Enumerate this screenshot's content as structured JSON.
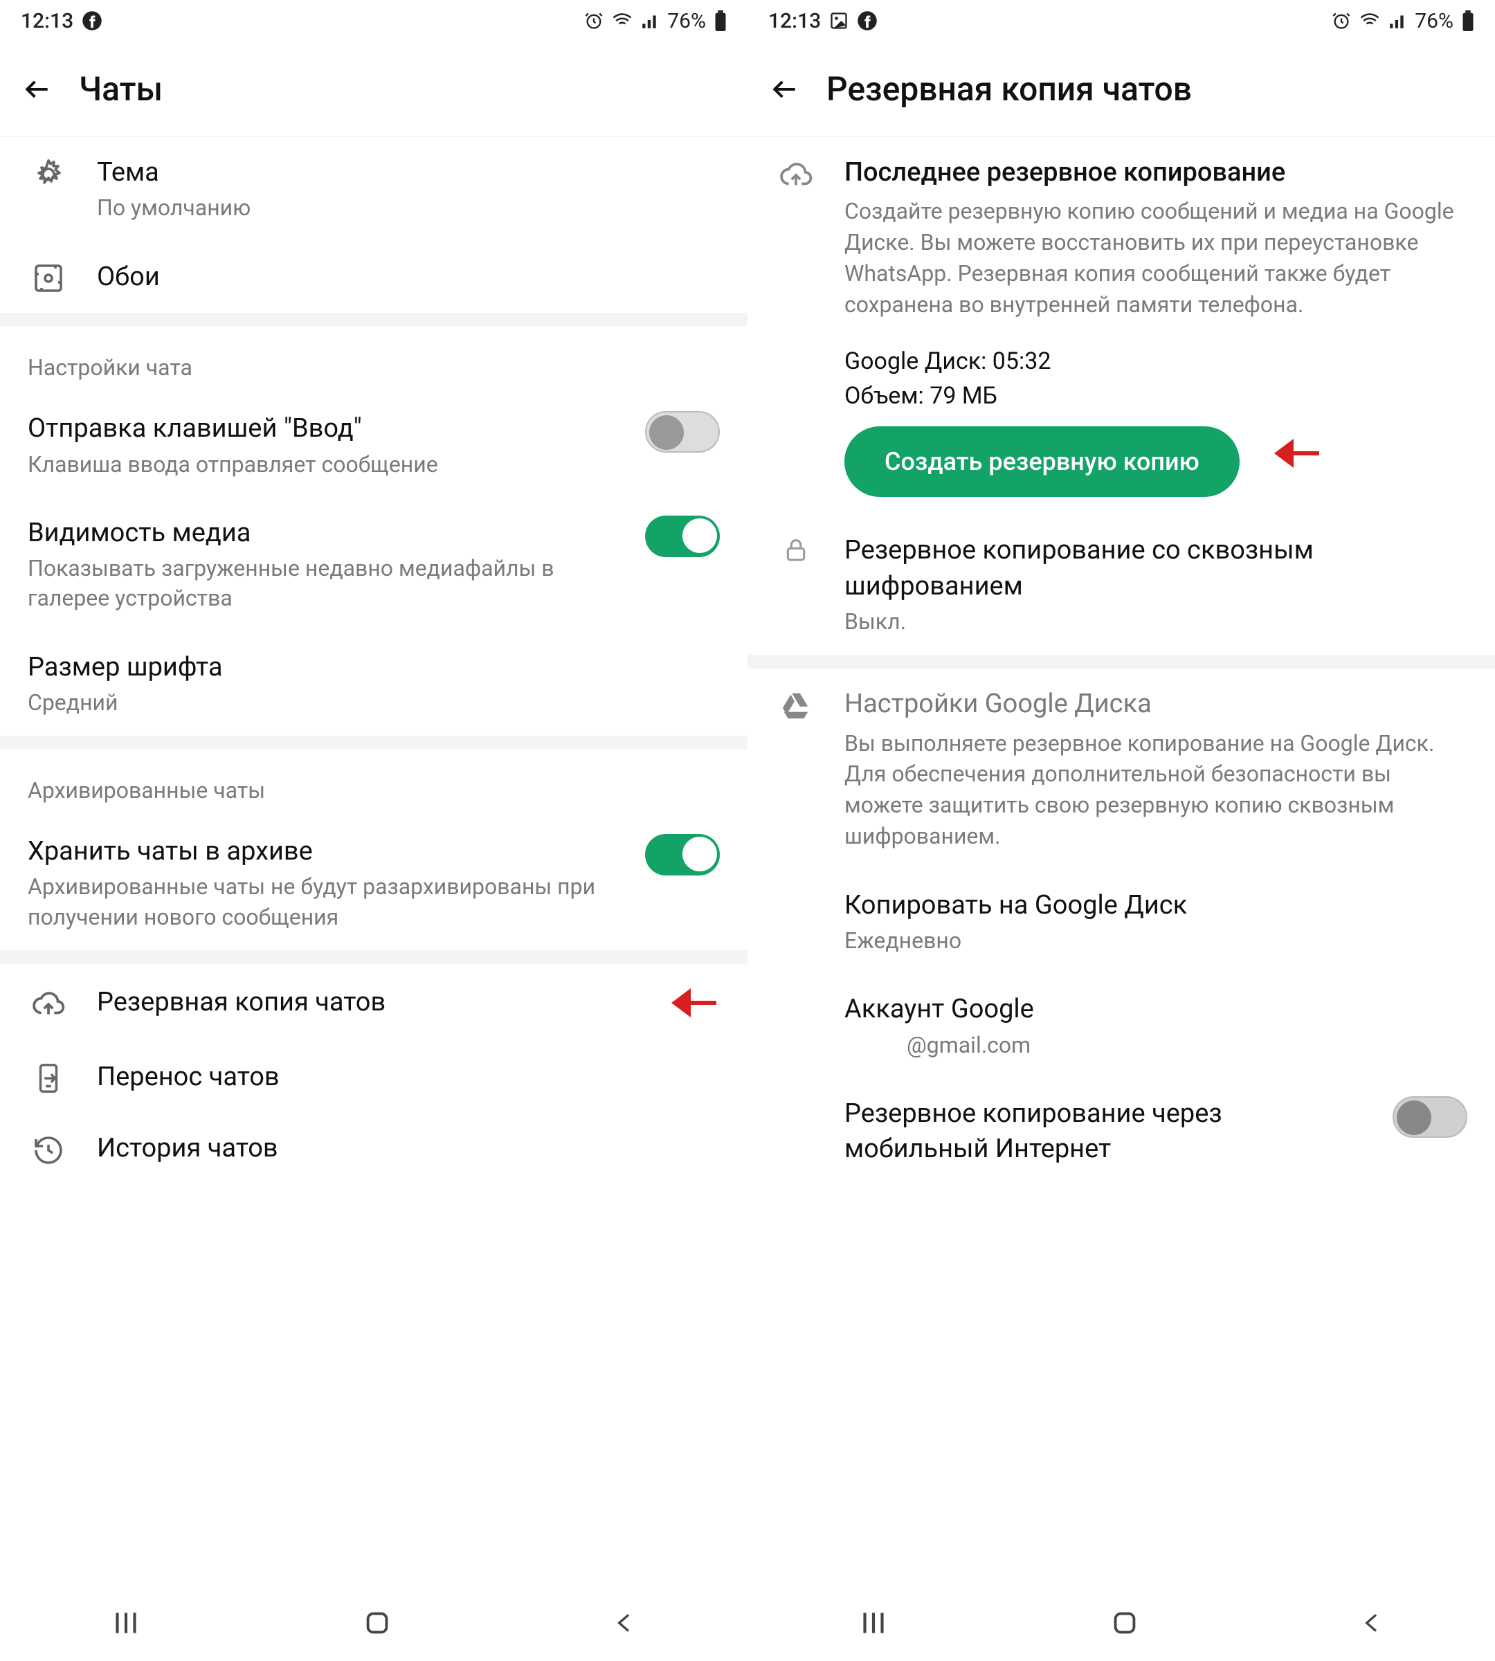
{
  "status": {
    "time": "12:13",
    "battery": "76%"
  },
  "left": {
    "title": "Чаты",
    "theme": {
      "title": "Тема",
      "value": "По умолчанию"
    },
    "wallpaper": {
      "title": "Обои"
    },
    "section_chat": "Настройки чата",
    "enter_send": {
      "title": "Отправка клавишей \"Ввод\"",
      "desc": "Клавиша ввода отправляет сообщение"
    },
    "media_vis": {
      "title": "Видимость медиа",
      "desc": "Показывать загруженные недавно медиафайлы в галерее устройства"
    },
    "font_size": {
      "title": "Размер шрифта",
      "value": "Средний"
    },
    "section_arch": "Архивированные чаты",
    "keep_arch": {
      "title": "Хранить чаты в архиве",
      "desc": "Архивированные чаты не будут разархивированы при получении нового сообщения"
    },
    "backup": {
      "title": "Резервная копия чатов"
    },
    "transfer": {
      "title": "Перенос чатов"
    },
    "history": {
      "title": "История чатов"
    }
  },
  "right": {
    "title": "Резервная копия чатов",
    "last_backup": {
      "header": "Последнее резервное копирование",
      "desc": "Создайте резервную копию сообщений и медиа на Google Диске. Вы можете восстановить их при переустановке WhatsApp. Резервная копия сообщений также будет сохранена во внутренней памяти телефона.",
      "gdrive_time": "Google Диск: 05:32",
      "size": "Объем: 79 МБ",
      "button": "Создать резервную копию"
    },
    "e2e": {
      "title": "Резервное копирование со сквозным шифрованием",
      "value": "Выкл."
    },
    "gdrive": {
      "header": "Настройки Google Диска",
      "desc": "Вы выполняете резервное копирование на Google Диск. Для обеспечения дополнительной безопасности вы можете защитить свою резервную копию сквозным шифрованием."
    },
    "copy_to": {
      "title": "Копировать на Google Диск",
      "value": "Ежедневно"
    },
    "account": {
      "title": "Аккаунт Google",
      "value": "@gmail.com"
    },
    "cellular": {
      "title": "Резервное копирование через мобильный Интернет"
    }
  }
}
